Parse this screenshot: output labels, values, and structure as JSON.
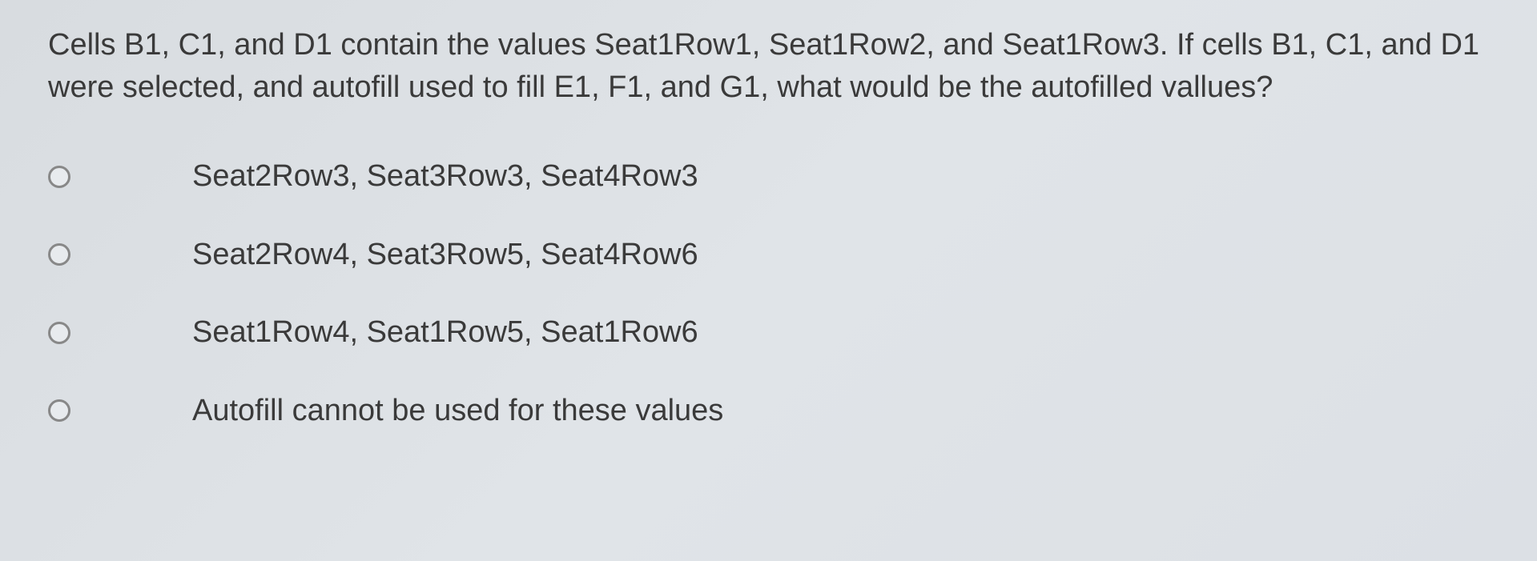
{
  "question": "Cells B1, C1, and D1 contain the values Seat1Row1, Seat1Row2, and Seat1Row3. If cells B1, C1, and D1 were selected, and autofill used to fill E1, F1, and G1, what would be the autofilled vallues?",
  "options": [
    "Seat2Row3, Seat3Row3, Seat4Row3",
    "Seat2Row4, Seat3Row5, Seat4Row6",
    "Seat1Row4, Seat1Row5, Seat1Row6",
    "Autofill cannot be used for these values"
  ]
}
